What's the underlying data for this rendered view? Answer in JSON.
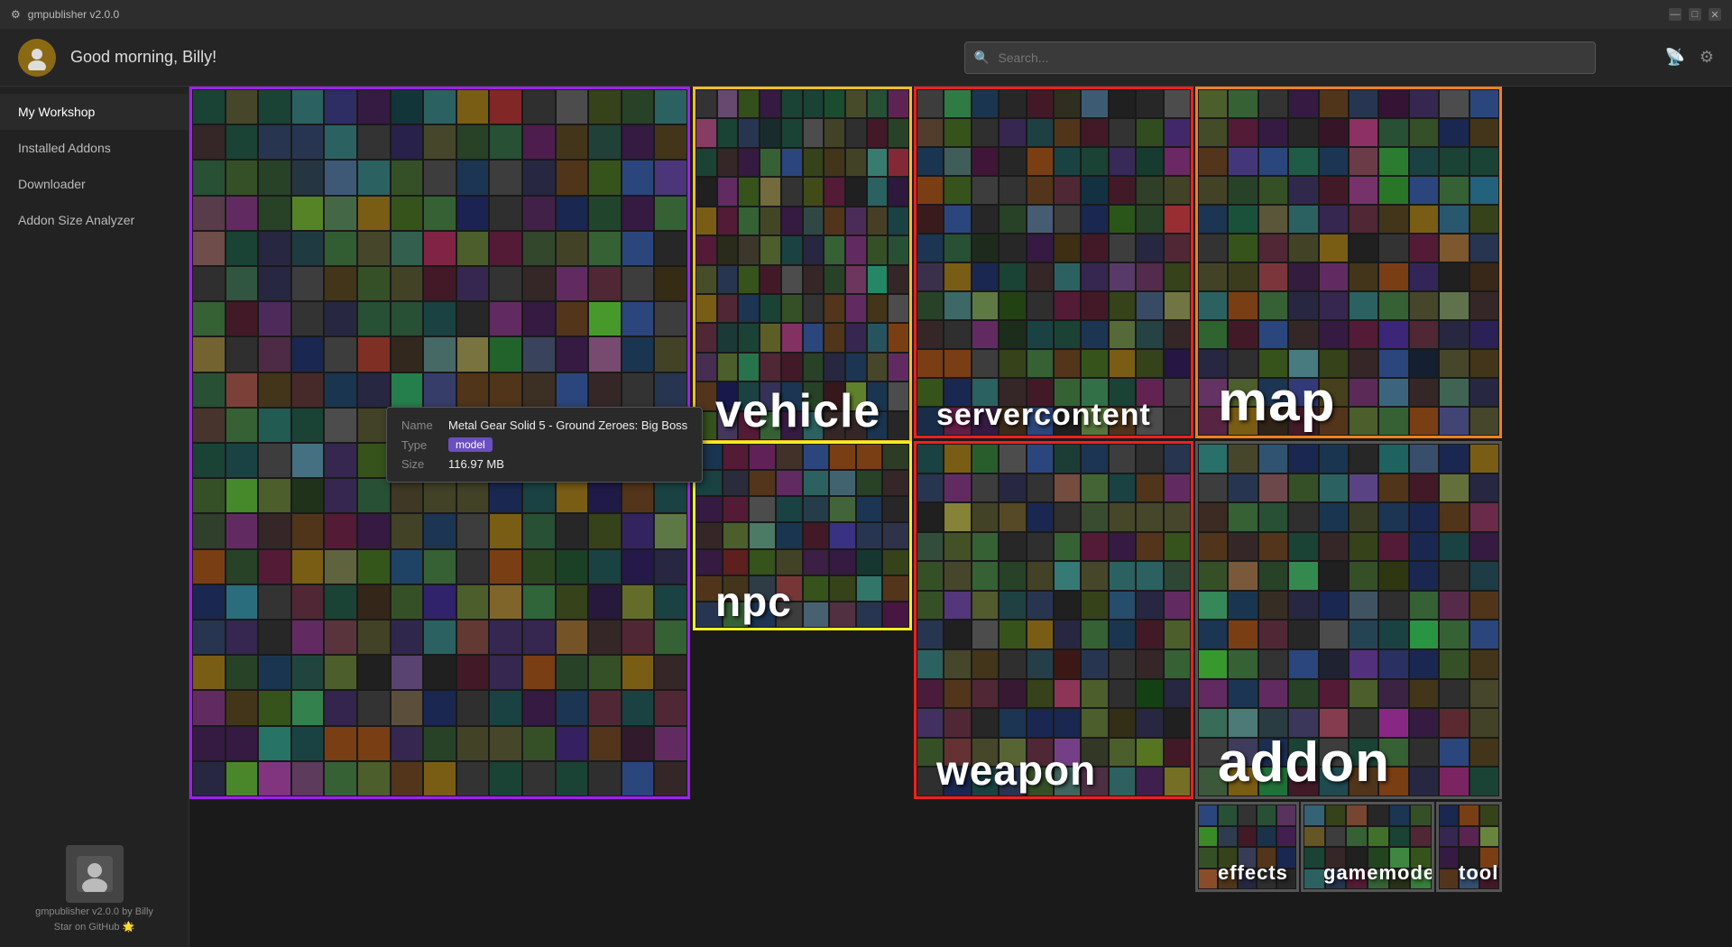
{
  "app": {
    "title": "gmpublisher v2.0.0",
    "version": "v2.0.0"
  },
  "titlebar": {
    "title": "gmpublisher v2.0.0",
    "minimize": "—",
    "maximize": "□",
    "close": "✕"
  },
  "header": {
    "greeting": "Good morning, Billy!",
    "search_placeholder": "Search...",
    "avatar_icon": "👤"
  },
  "sidebar": {
    "items": [
      {
        "id": "my-workshop",
        "label": "My Workshop",
        "active": true
      },
      {
        "id": "installed-addons",
        "label": "Installed Addons",
        "active": false
      },
      {
        "id": "downloader",
        "label": "Downloader",
        "active": false
      },
      {
        "id": "addon-size-analyzer",
        "label": "Addon Size Analyzer",
        "active": false
      }
    ],
    "footer": {
      "app_name": "gmpublisher v2.0.0 by Billy",
      "github_link": "Star on GitHub 🌟"
    }
  },
  "tooltip": {
    "name_label": "Name",
    "name_value": "Metal Gear Solid 5 - Ground Zeroes: Big Boss",
    "type_label": "Type",
    "type_value": "model",
    "size_label": "Size",
    "size_value": "116.97 MB"
  },
  "treemap": {
    "segments": [
      {
        "id": "model",
        "label": "",
        "border_color": "#a020f0",
        "cols": 15,
        "rows": 20
      },
      {
        "id": "vehicle",
        "label": "vehicle",
        "border_color": "#f0c020",
        "cols": 12,
        "rows": 10
      },
      {
        "id": "servercontent",
        "label": "servercontent",
        "border_color": "#f02020",
        "cols": 12,
        "rows": 10
      },
      {
        "id": "map",
        "label": "map",
        "border_color": "#f08020",
        "cols": 10,
        "rows": 10
      },
      {
        "id": "weapon",
        "label": "weapon",
        "border_color": "#f02020",
        "cols": 10,
        "rows": 10
      },
      {
        "id": "addon",
        "label": "addon",
        "border_color": "#404040",
        "cols": 10,
        "rows": 10
      },
      {
        "id": "npc",
        "label": "npc",
        "border_color": "#f0f020",
        "cols": 8,
        "rows": 5
      },
      {
        "id": "effects",
        "label": "effects",
        "border_color": "#404040",
        "cols": 5,
        "rows": 3
      },
      {
        "id": "gamemode",
        "label": "gamemode",
        "border_color": "#404040",
        "cols": 5,
        "rows": 3
      },
      {
        "id": "tool",
        "label": "tool",
        "border_color": "#404040",
        "cols": 4,
        "rows": 3
      }
    ]
  }
}
